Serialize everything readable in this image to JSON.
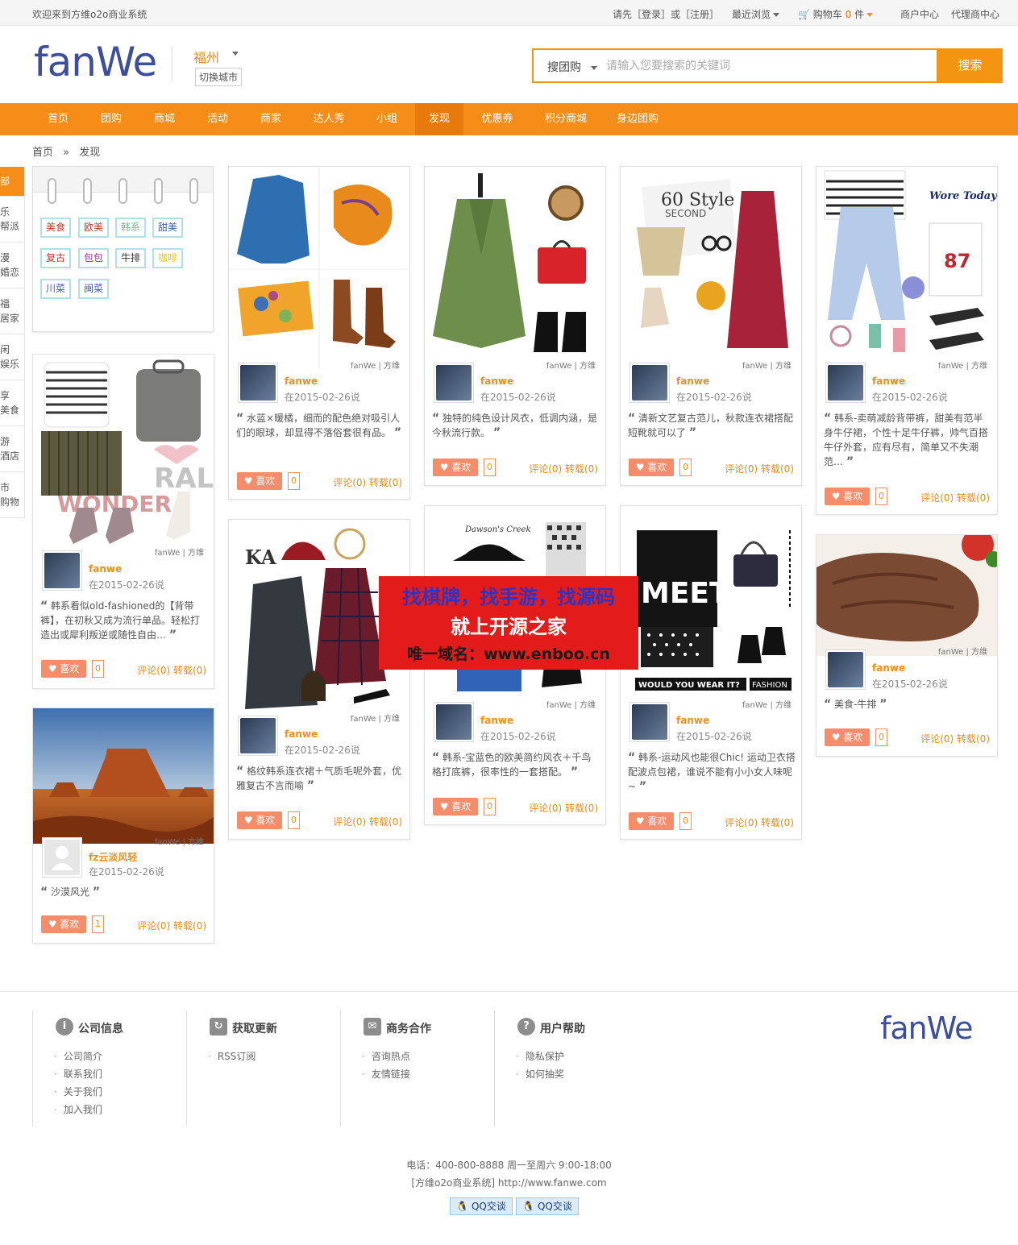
{
  "topbar": {
    "welcome": "欢迎来到方维o2o商业系统",
    "login_prompt": "请先［登录］或［注册］",
    "recent": "最近浏览",
    "cart_label": "购物车",
    "cart_count": "0",
    "cart_unit": "件",
    "merchant_center": "商户中心",
    "agent_center": "代理商中心"
  },
  "header": {
    "logo": "fanWe",
    "city": "福州",
    "switch_city": "切换城市",
    "search_type": "搜团购",
    "search_placeholder": "请输入您要搜索的关键词",
    "search_button": "搜索"
  },
  "nav": {
    "items": [
      "首页",
      "团购",
      "商城",
      "活动",
      "商家",
      "达人秀",
      "小组",
      "发现",
      "优惠券",
      "积分商城",
      "身边团购"
    ],
    "active": "发现"
  },
  "breadcrumb": {
    "home": "首页",
    "sep": "»",
    "current": "发现"
  },
  "side_tabs": [
    "全部",
    "玩乐\n帮派",
    "浪漫\n婚恋",
    "幸福\n居家",
    "休闲\n娱乐",
    "乐享\n美食",
    "旅游\n酒店",
    "都市\n购物"
  ],
  "tags": [
    {
      "label": "美食",
      "color": "#c9342a"
    },
    {
      "label": "欧美",
      "color": "#c9342a"
    },
    {
      "label": "韩系",
      "color": "#6bbd8c"
    },
    {
      "label": "甜美",
      "color": "#3f5a9c"
    },
    {
      "label": "复古",
      "color": "#c9342a"
    },
    {
      "label": "包包",
      "color": "#8c2fa0"
    },
    {
      "label": "牛排",
      "color": "#333333"
    },
    {
      "label": "咖啡",
      "color": "#e0c720"
    },
    {
      "label": "川菜",
      "color": "#3f5a9c"
    },
    {
      "label": "闽菜",
      "color": "#3f5a9c"
    }
  ],
  "posts": [
    {
      "user": "fanwe",
      "date": "在2015-02-26说",
      "desc": "韩系看似old-fashioned的【背带裤】，在初秋又成为流行单品。轻松打造出或犀利叛逆或随性自由…",
      "likes": "0",
      "stats": "评论(0) 转载(0)",
      "like_label": "喜欢",
      "watermark": "fanWe | 方维"
    },
    {
      "user": "fz云淡风轻",
      "date": "在2015-02-26说",
      "desc": "沙漠风光",
      "likes": "1",
      "stats": "评论(0) 转载(0)",
      "like_label": "喜欢",
      "watermark": "fanWe | 方维"
    },
    {
      "user": "fanwe",
      "date": "在2015-02-26说",
      "desc": "水蓝×暖橘，细而的配色绝对吸引人们的眼球，却显得不落俗套很有品。",
      "likes": "0",
      "stats": "评论(0) 转载(0)",
      "like_label": "喜欢",
      "watermark": "fanWe | 方维"
    },
    {
      "user": "fanwe",
      "date": "在2015-02-26说",
      "desc": "格纹韩系连衣裙＋气质毛呢外套，优雅复古不言而喻",
      "likes": "0",
      "stats": "评论(0) 转载(0)",
      "like_label": "喜欢",
      "watermark": "fanWe | 方维"
    },
    {
      "user": "fanwe",
      "date": "在2015-02-26说",
      "desc": "独特的纯色设计风衣，低调内涵，是今秋流行款。",
      "likes": "0",
      "stats": "评论(0) 转载(0)",
      "like_label": "喜欢",
      "watermark": "fanWe | 方维"
    },
    {
      "user": "fanwe",
      "date": "在2015-02-26说",
      "desc": "韩系-宝蓝色的欧美简约风衣＋千鸟格打底裤，很率性的一套搭配。",
      "likes": "0",
      "stats": "评论(0) 转载(0)",
      "like_label": "喜欢",
      "watermark": "fanWe | 方维"
    },
    {
      "user": "fanwe",
      "date": "在2015-02-26说",
      "desc": "清新文艺复古范儿，秋款连衣裙搭配短靴就可以了",
      "likes": "0",
      "stats": "评论(0) 转载(0)",
      "like_label": "喜欢",
      "watermark": "fanWe | 方维"
    },
    {
      "user": "fanwe",
      "date": "在2015-02-26说",
      "desc": "韩系-运动风也能很Chic! 运动卫衣搭配波点包裙，谁说不能有小小女人味呢~",
      "likes": "0",
      "stats": "评论(0) 转载(0)",
      "like_label": "喜欢",
      "watermark": "fanWe | 方维"
    },
    {
      "user": "fanwe",
      "date": "在2015-02-26说",
      "desc": "韩系-卖萌减龄背带裤，甜美有范半身牛仔裙，个性十足牛仔裤，帅气百搭牛仔外套，应有尽有，简单又不失潮范…",
      "likes": "0",
      "stats": "评论(0) 转载(0)",
      "like_label": "喜欢",
      "watermark": "fanWe | 方维"
    },
    {
      "user": "fanwe",
      "date": "在2015-02-26说",
      "desc": "美食-牛排",
      "likes": "0",
      "stats": "评论(0) 转载(0)",
      "like_label": "喜欢",
      "watermark": "fanWe | 方维"
    }
  ],
  "image_text": {
    "sixty_style": "60 Style",
    "second": "SECOND",
    "wore_today": "Wore Today",
    "ral": "RAL",
    "wonder": "WONDER",
    "meet": "MEET",
    "would_you": "WOULD YOU WEAR IT?",
    "fashion": "FASHION",
    "ka": "KA",
    "dawsons": "Dawson's Creek",
    "n87": "87"
  },
  "promo": {
    "line1": "找棋牌，找手游，找源码",
    "line2": "就上开源之家",
    "line3": "唯一域名：www.enboo.cn"
  },
  "footer": {
    "columns": [
      {
        "icon": "i",
        "title": "公司信息",
        "links": [
          "公司简介",
          "联系我们",
          "关于我们",
          "加入我们"
        ]
      },
      {
        "icon": "↻",
        "title": "获取更新",
        "links": [
          "RSS订阅"
        ]
      },
      {
        "icon": "✉",
        "title": "商务合作",
        "links": [
          "咨询热点",
          "友情链接"
        ]
      },
      {
        "icon": "?",
        "title": "用户帮助",
        "links": [
          "隐私保护",
          "如何抽奖"
        ]
      }
    ],
    "logo": "fanWe",
    "phone": "电话：400-800-8888 周一至周六 9:00-18:00",
    "site": "[方维o2o商业系统] http://www.fanwe.com",
    "qq_label": "QQ交谈"
  },
  "colors": {
    "accent": "#f58d18",
    "brand_blue": "#3c4f9c",
    "promo_red": "#e31b1b"
  }
}
